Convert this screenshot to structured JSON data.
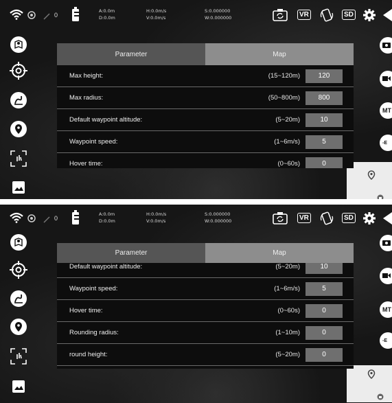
{
  "status": {
    "signal_count": "0",
    "a": "A:0.0m",
    "d": "D:0.0m",
    "h": "H:0.0m/s",
    "v": "V:0.0m/s",
    "s": "S:0.000000",
    "w": "W:0.000000",
    "vr_label": "VR",
    "sd_label": "SD"
  },
  "right_rail": {
    "mt_label": "MT",
    "ev_label": "-E"
  },
  "dialog": {
    "tab_parameter": "Parameter",
    "tab_map": "Map"
  },
  "panel1_rows": [
    {
      "label": "Max height:",
      "range": "(15~120m)",
      "value": "120"
    },
    {
      "label": "Max radius:",
      "range": "(50~800m)",
      "value": "800"
    },
    {
      "label": "Default waypoint altitude:",
      "range": "(5~20m)",
      "value": "10"
    },
    {
      "label": "Waypoint speed:",
      "range": "(1~6m/s)",
      "value": "5"
    },
    {
      "label": "Hover time:",
      "range": "(0~60s)",
      "value": "0"
    }
  ],
  "panel2_rows": [
    {
      "label": "Default waypoint altitude:",
      "range": "(5~20m)",
      "value": "10"
    },
    {
      "label": "Waypoint speed:",
      "range": "(1~6m/s)",
      "value": "5"
    },
    {
      "label": "Hover time:",
      "range": "(0~60s)",
      "value": "0"
    },
    {
      "label": "Rounding radius:",
      "range": "(1~10m)",
      "value": "0"
    },
    {
      "label": "round height:",
      "range": "(5~20m)",
      "value": "0"
    }
  ]
}
